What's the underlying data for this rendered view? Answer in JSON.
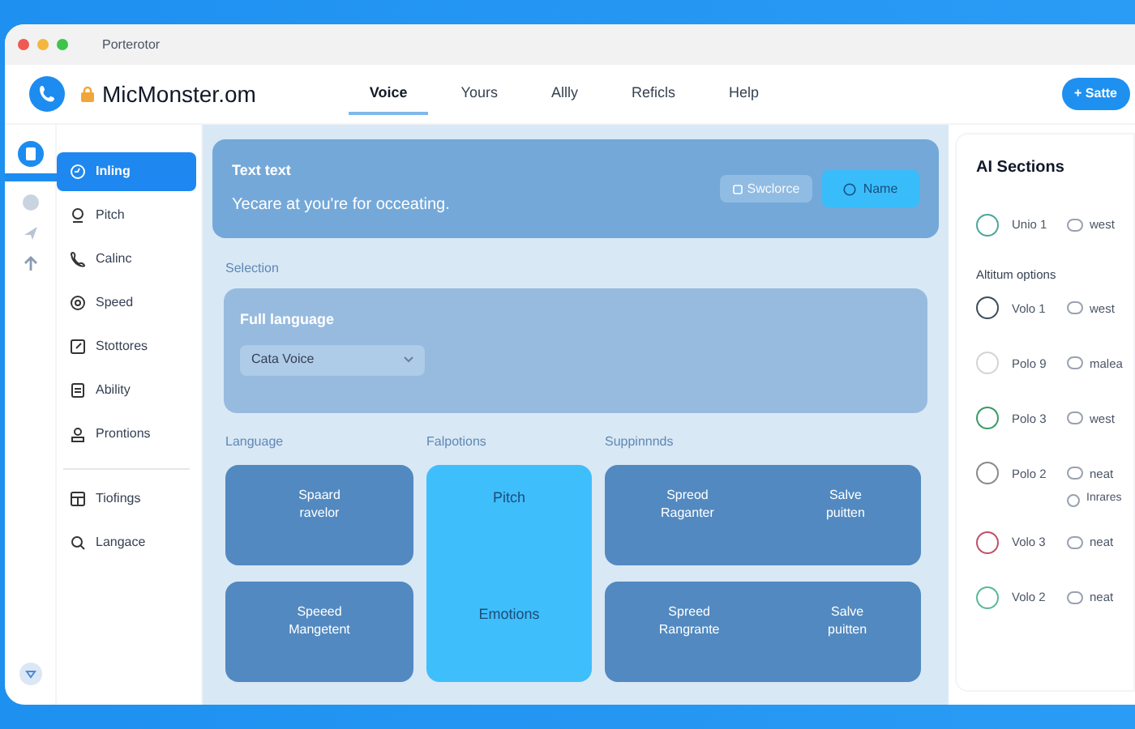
{
  "window": {
    "title": "Porterotor"
  },
  "header": {
    "site": "MicMonster.om",
    "button": "+ Satte"
  },
  "tabs": [
    {
      "label": "Voice",
      "selected": true
    },
    {
      "label": "Yours",
      "selected": false
    },
    {
      "label": "Allly",
      "selected": false
    },
    {
      "label": "Reficls",
      "selected": false
    },
    {
      "label": "Help",
      "selected": false
    }
  ],
  "sidebar": {
    "groups": [
      {
        "items": [
          {
            "label": "Inling",
            "selected": true
          },
          {
            "label": "Pitch",
            "selected": false
          },
          {
            "label": "Calinc",
            "selected": false
          },
          {
            "label": "Speed",
            "selected": false
          },
          {
            "label": "Stottores",
            "selected": false
          },
          {
            "label": "Ability",
            "selected": false
          },
          {
            "label": "Prontions",
            "selected": false
          }
        ]
      },
      {
        "items": [
          {
            "label": "Tiofings",
            "selected": false
          },
          {
            "label": "Langace",
            "selected": false
          }
        ]
      }
    ]
  },
  "banner": {
    "title": "Text text",
    "text": "Yecare at you're for occeating.",
    "buttons": [
      {
        "label": "Swclorce",
        "kind": "secondary"
      },
      {
        "label": "Name",
        "kind": "primary"
      }
    ]
  },
  "selection": {
    "heading": "Selection",
    "card_title": "Full language",
    "dropdown": "Cata Voice"
  },
  "groups": [
    {
      "heading": "Language",
      "tiles": [
        {
          "lines": [
            "Spaard\nravelor"
          ]
        },
        {
          "lines": [
            "Speeed\nMangetent"
          ]
        }
      ]
    },
    {
      "heading": "Falpotions",
      "tiles": [
        {
          "lines": [
            "Pitch",
            "Emotions"
          ]
        }
      ]
    },
    {
      "heading": "Suppinnnds",
      "tiles": [
        {
          "lines": [
            "Spreod\nRaganter",
            "Salve\npuitten"
          ]
        },
        {
          "lines": [
            "Spreed\nRangrante",
            "Salve\npuitten"
          ]
        }
      ]
    }
  ],
  "right_panel": {
    "title": "AI Sections",
    "rows": [
      {
        "kind": "option",
        "label": "Unio 1",
        "tag": "west",
        "color": "#4aa79a"
      },
      {
        "kind": "heading",
        "label": "Altitum options"
      },
      {
        "kind": "option",
        "label": "Volo 1",
        "tag": "west",
        "color": "#3d4d5c"
      },
      {
        "kind": "option",
        "label": "Polo 9",
        "tag": "malea",
        "color": "#d4d4d4"
      },
      {
        "kind": "option",
        "label": "Polo 3",
        "tag": "west",
        "color": "#3a9a6a"
      },
      {
        "kind": "option",
        "label": "Polo 2",
        "tag": "neat",
        "color": "#8a8a8a",
        "extra": "Inrares"
      },
      {
        "kind": "option",
        "label": "Volo 3",
        "tag": "neat",
        "color": "#c0506a"
      },
      {
        "kind": "option",
        "label": "Volo 2",
        "tag": "neat",
        "color": "#5ab89a"
      }
    ]
  }
}
